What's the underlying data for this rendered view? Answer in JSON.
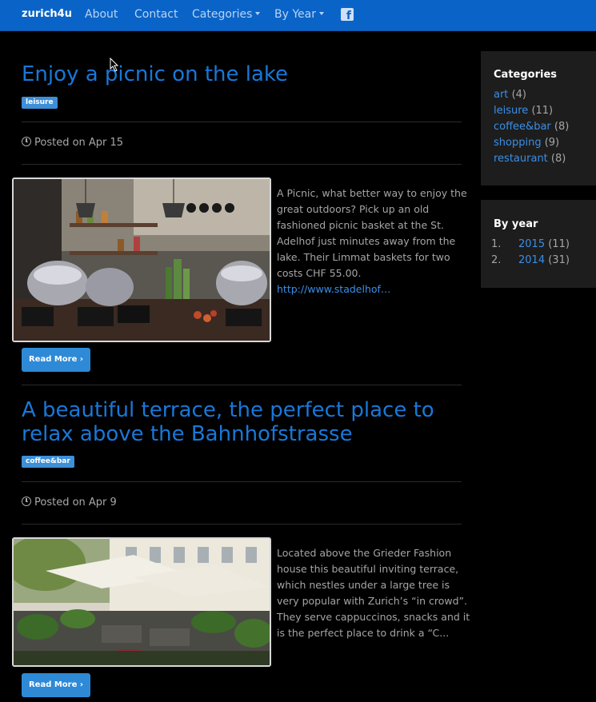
{
  "nav": {
    "brand": "zurich4u",
    "about": "About",
    "contact": "Contact",
    "categories": "Categories",
    "by_year": "By Year",
    "facebook_icon": "facebook-icon"
  },
  "posts": [
    {
      "title": "Enjoy a picnic on the lake",
      "tag": "leisure",
      "posted": "Posted on Apr 15",
      "excerpt": "A Picnic, what better way to enjoy the great outdoors? Pick up an old fashioned picnic basket at the St. Adelhof just minutes away from the lake. Their Limmat baskets for two costs CHF 55.00.",
      "link": "http://www.stadelhof…",
      "read_more": "Read More ›",
      "image_alt": "Deli counter with copper pots and hanging lamps"
    },
    {
      "title": "A beautiful terrace, the perfect place to relax above the Bahnhofstrasse",
      "tag": "coffee&bar",
      "posted": "Posted on Apr 9",
      "excerpt": "Located above the Grieder Fashion house this beautiful inviting terrace, which nestles under a large tree is very popular with Zurich’s “in crowd”. They serve cappuccinos, snacks and it is the perfect place to drink a “C...",
      "read_more": "Read More ›",
      "image_alt": "Terrace with umbrellas and lounge chairs"
    }
  ],
  "sidebar": {
    "categories_title": "Categories",
    "categories": [
      {
        "name": "art",
        "count": "(4)"
      },
      {
        "name": "leisure",
        "count": "(11)"
      },
      {
        "name": "coffee&bar",
        "count": "(8)"
      },
      {
        "name": "shopping",
        "count": "(9)"
      },
      {
        "name": "restaurant",
        "count": "(8)"
      }
    ],
    "years_title": "By year",
    "years": [
      {
        "num": "1.",
        "year": "2015",
        "count": "(11)"
      },
      {
        "num": "2.",
        "year": "2014",
        "count": "(31)"
      }
    ]
  },
  "colors": {
    "navbar": "#0a64c8",
    "link": "#3a8ee8",
    "title": "#1878d8",
    "button": "#2e8ad6",
    "background": "#000000",
    "sidebar": "#1d1d1d"
  }
}
